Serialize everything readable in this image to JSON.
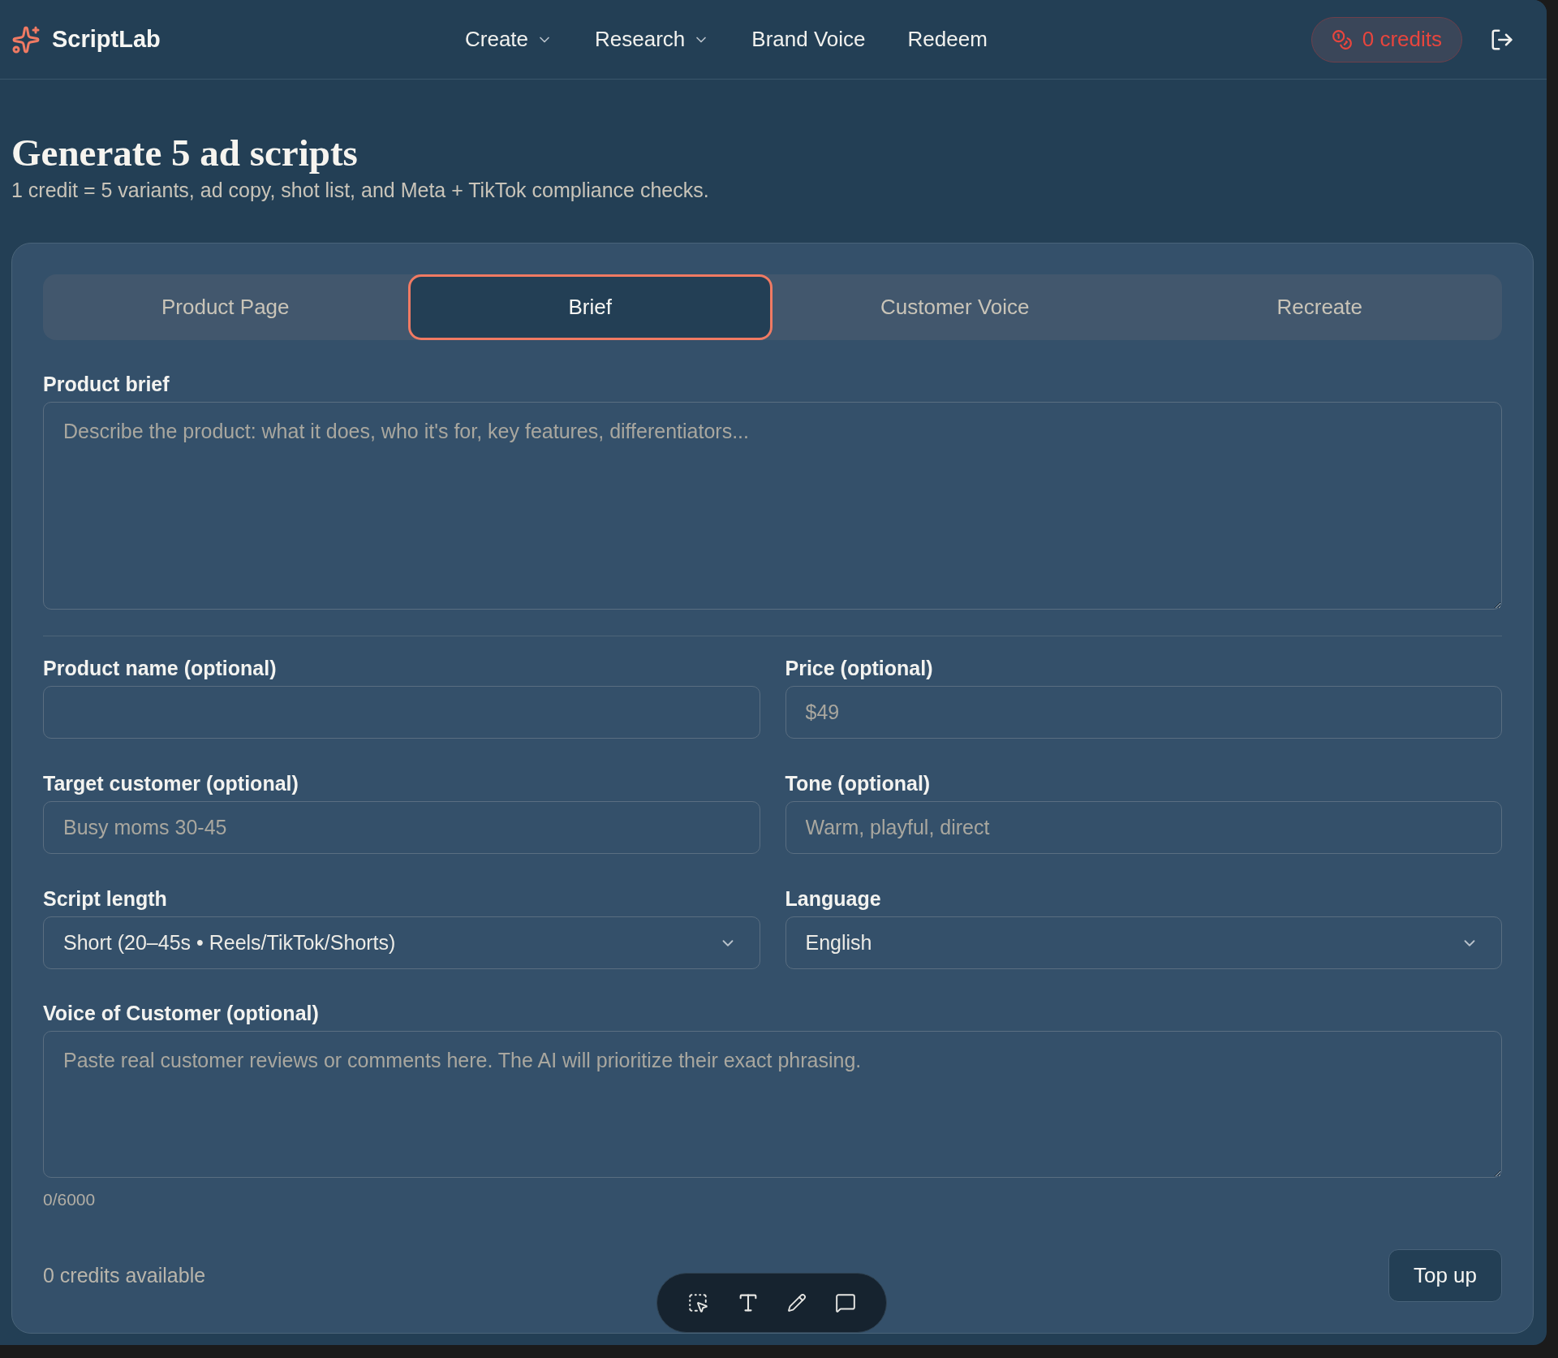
{
  "header": {
    "brand": "ScriptLab",
    "nav": [
      {
        "label": "Create",
        "kind": "dropdown"
      },
      {
        "label": "Research",
        "kind": "dropdown"
      },
      {
        "label": "Brand Voice",
        "kind": "link"
      },
      {
        "label": "Redeem",
        "kind": "link"
      }
    ],
    "credits": "0 credits"
  },
  "page": {
    "title": "Generate 5 ad scripts",
    "subtitle": "1 credit = 5 variants, ad copy, shot list, and Meta + TikTok compliance checks."
  },
  "tabs": [
    {
      "label": "Product Page",
      "selected": false
    },
    {
      "label": "Brief",
      "selected": true
    },
    {
      "label": "Customer Voice",
      "selected": false
    },
    {
      "label": "Recreate",
      "selected": false
    }
  ],
  "product_brief": {
    "label": "Product brief",
    "placeholder": "Describe the product: what it does, who it's for, key features, differentiators..."
  },
  "fields": [
    {
      "kind": "input",
      "label": "Product name (optional)"
    },
    {
      "kind": "input",
      "label": "Price (optional)",
      "placeholder": "$49"
    },
    {
      "kind": "input",
      "label": "Target customer (optional)",
      "placeholder": "Busy moms 30-45"
    },
    {
      "kind": "input",
      "label": "Tone (optional)",
      "placeholder": "Warm, playful, direct"
    },
    {
      "kind": "select",
      "label": "Script length",
      "value": "Short (20–45s • Reels/TikTok/Shorts)"
    },
    {
      "kind": "select",
      "label": "Language",
      "value": "English"
    }
  ],
  "voice_of_customer": {
    "label": "Voice of Customer (optional)",
    "placeholder": "Paste real customer reviews or comments here. The AI will prioritize their exact phrasing.",
    "counter": "0/6000"
  },
  "footer": {
    "credits_available": "0 credits available",
    "top_up": "Top up"
  }
}
